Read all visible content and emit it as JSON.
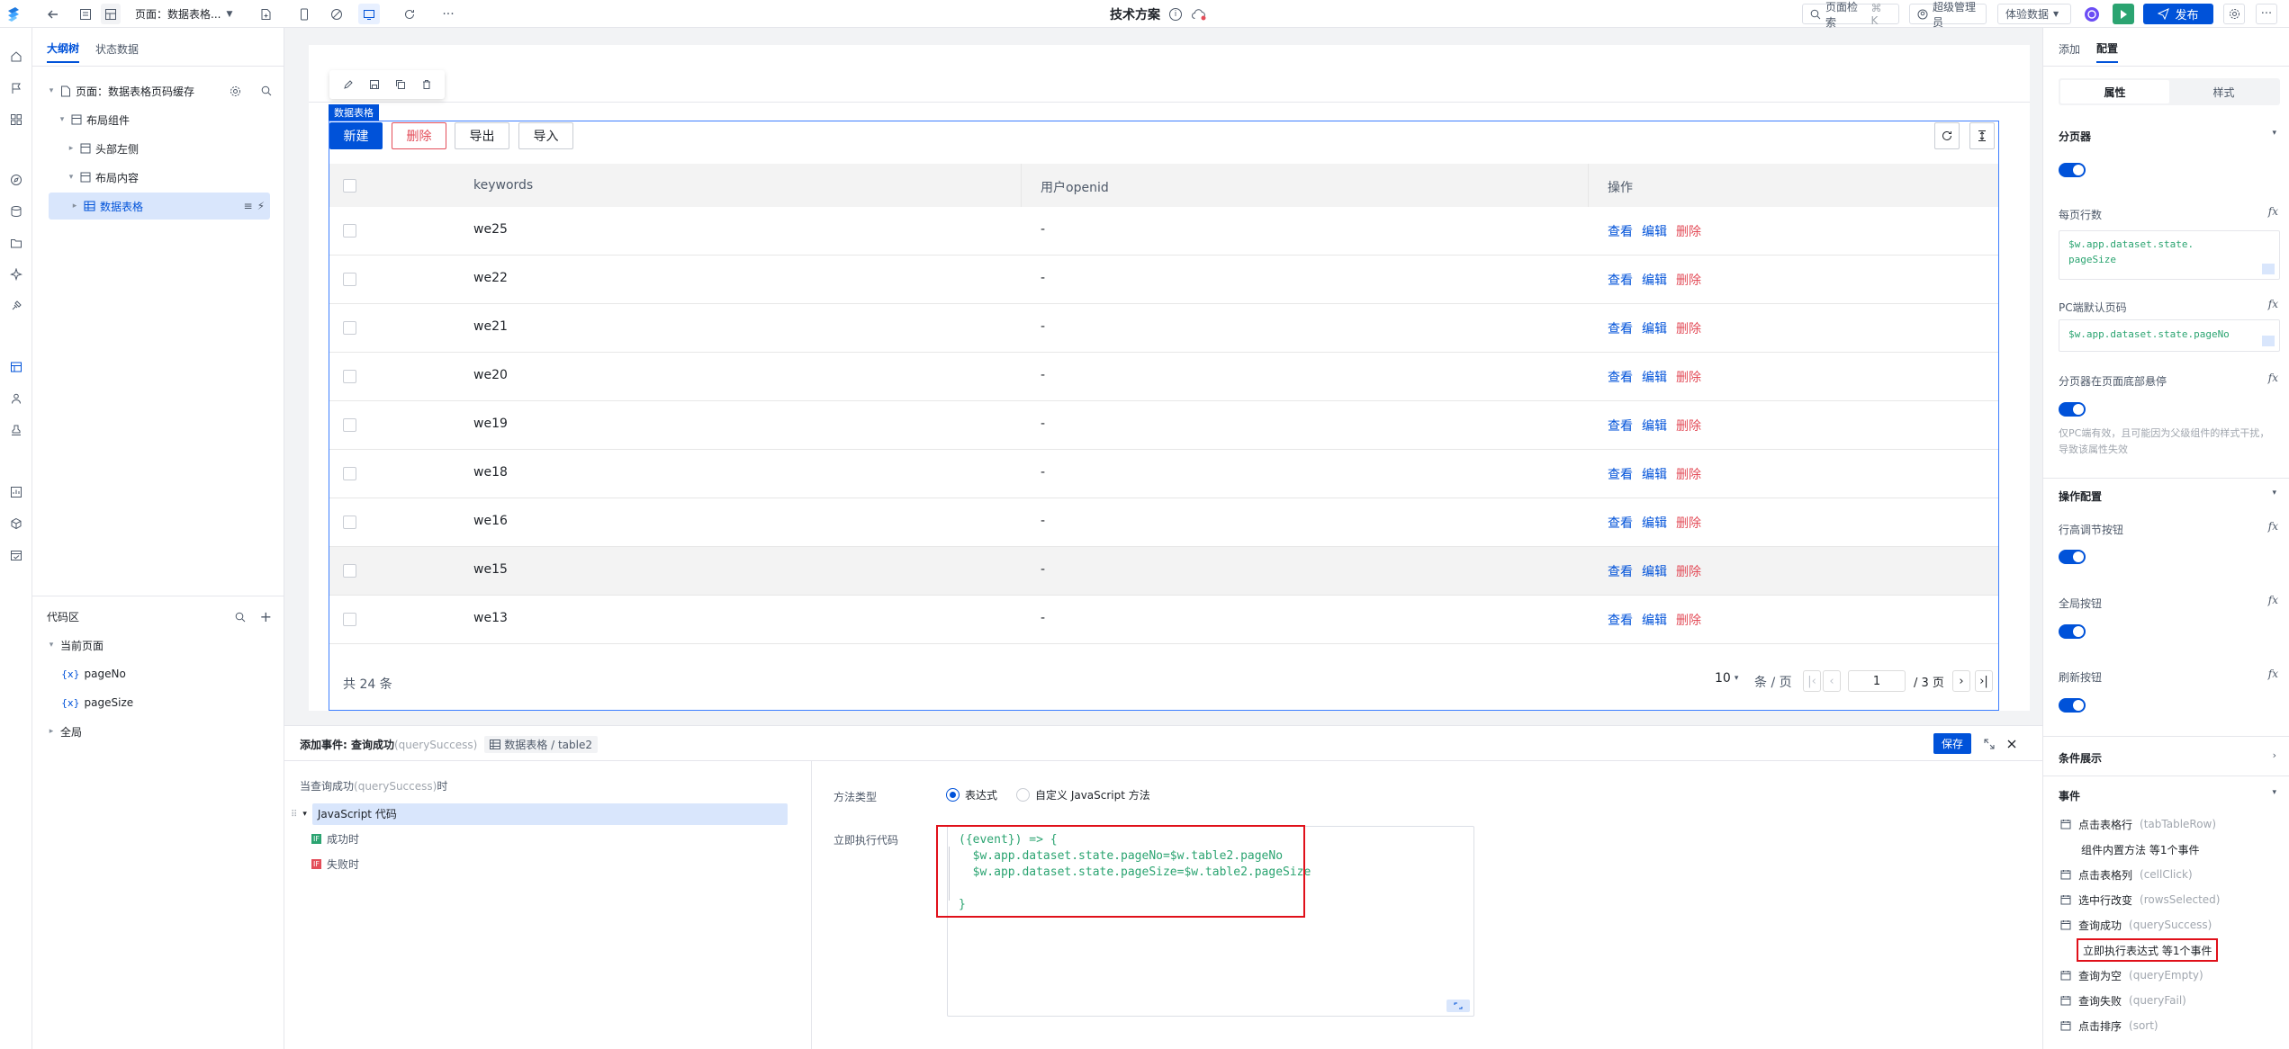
{
  "topbar": {
    "page_label": "页面：数据表格...",
    "title": "技术方案",
    "search_label": "页面检索",
    "search_shortcut": "⌘ K",
    "user": "超级管理员",
    "env": "体验数据",
    "publish": "发布"
  },
  "tree": {
    "tabs": [
      "大纲树",
      "状态数据"
    ],
    "items": [
      {
        "label": "页面：数据表格页码缓存"
      },
      {
        "label": "布局组件"
      },
      {
        "label": "头部左侧"
      },
      {
        "label": "布局内容"
      },
      {
        "label": "数据表格"
      }
    ],
    "code_title": "代码区",
    "code_items": [
      {
        "label": "当前页面"
      },
      {
        "label": "pageNo",
        "tag": "{x}"
      },
      {
        "label": "pageSize",
        "tag": "{x}"
      },
      {
        "label": "全局"
      }
    ]
  },
  "canvas": {
    "component_tag": "数据表格",
    "buttons": {
      "new": "新建",
      "delete": "删除",
      "export": "导出",
      "import": "导入"
    },
    "columns": [
      "keywords",
      "用户openid",
      "操作"
    ],
    "rows": [
      {
        "keyword": "we25",
        "openid": "-"
      },
      {
        "keyword": "we22",
        "openid": "-"
      },
      {
        "keyword": "we21",
        "openid": "-"
      },
      {
        "keyword": "we20",
        "openid": "-"
      },
      {
        "keyword": "we19",
        "openid": "-"
      },
      {
        "keyword": "we18",
        "openid": "-"
      },
      {
        "keyword": "we16",
        "openid": "-"
      },
      {
        "keyword": "we15",
        "openid": "-"
      },
      {
        "keyword": "we13",
        "openid": "-"
      }
    ],
    "actions": {
      "view": "查看",
      "edit": "编辑",
      "delete": "删除"
    },
    "total_text": "共 24 条",
    "page_size": "10",
    "page_size_unit": "条 / 页",
    "current_page": "1",
    "total_pages": "/ 3 页"
  },
  "event_panel": {
    "title": "添加事件: 查询成功",
    "title_sub": "(querySuccess)",
    "breadcrumb": "数据表格 / table2",
    "save": "保存",
    "when_prefix": "当查询成功",
    "when_sub": "(querySuccess)",
    "when_suffix": "时",
    "action_selected": "JavaScript 代码",
    "on_success": "成功时",
    "on_fail": "失败时",
    "method_type_label": "方法类型",
    "radio_expression": "表达式",
    "radio_custom": "自定义 JavaScript 方法",
    "code_label": "立即执行代码",
    "code_lines": [
      "({event}) => {",
      "  $w.app.dataset.state.pageNo=$w.table2.pageNo",
      "  $w.app.dataset.state.pageSize=$w.table2.pageSize",
      "",
      "}"
    ]
  },
  "right_panel": {
    "tabs": [
      "添加",
      "配置"
    ],
    "seg": [
      "属性",
      "样式"
    ],
    "pager_section": "分页器",
    "rows_per_page_label": "每页行数",
    "rows_per_page_value": "$w.app.dataset.state.\npageSize",
    "pc_page_label": "PC端默认页码",
    "pc_page_value": "$w.app.dataset.state.pageNo",
    "sticky_label": "分页器在页面底部悬停",
    "sticky_note": "仅PC端有效，且可能因为父级组件的样式干扰，导致该属性失效",
    "ops_section": "操作配置",
    "row_height_label": "行高调节按钮",
    "fullscreen_label": "全局按钮",
    "refresh_label": "刷新按钮",
    "cond_section": "条件展示",
    "events_section": "事件",
    "events": [
      {
        "label": "点击表格行",
        "sub": "(tabTableRow)"
      },
      {
        "label": "组件内置方法 等1个事件",
        "sub": "",
        "indent": true
      },
      {
        "label": "点击表格列",
        "sub": "(cellClick)"
      },
      {
        "label": "选中行改变",
        "sub": "(rowsSelected)"
      },
      {
        "label": "查询成功",
        "sub": "(querySuccess)"
      },
      {
        "label": "立即执行表达式 等1个事件",
        "sub": "",
        "indent": true,
        "highlight": true
      },
      {
        "label": "查询为空",
        "sub": "(queryEmpty)"
      },
      {
        "label": "查询失败",
        "sub": "(queryFail)"
      },
      {
        "label": "点击排序",
        "sub": "(sort)"
      }
    ]
  }
}
